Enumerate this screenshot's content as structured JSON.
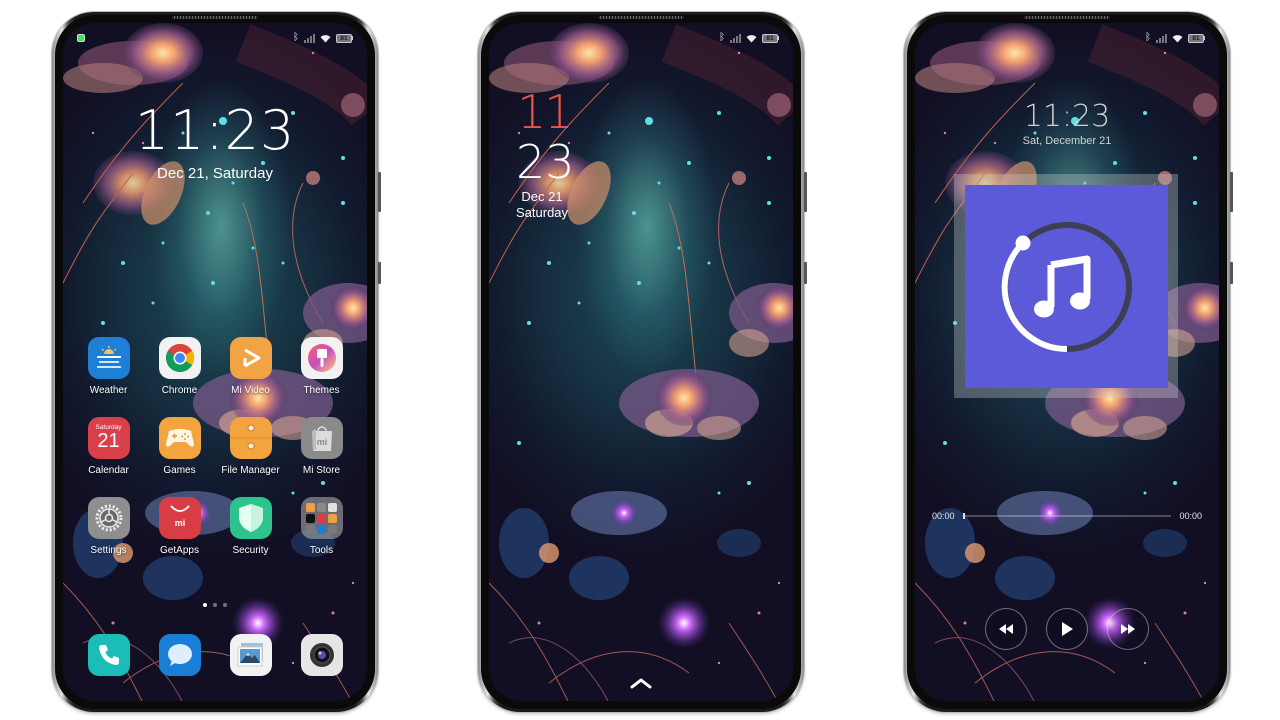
{
  "status_bar": {
    "battery_level": "81",
    "bluetooth_icon": "bluetooth-icon",
    "signal_icon": "signal-icon",
    "wifi_icon": "wifi-icon"
  },
  "home_screen": {
    "time": "11:23",
    "date": "Dec 21, Saturday",
    "apps": [
      {
        "label": "Weather",
        "icon": "weather-icon",
        "color": "#1e7fd6"
      },
      {
        "label": "Chrome",
        "icon": "chrome-icon",
        "color": "#f2f2f2"
      },
      {
        "label": "Mi Video",
        "icon": "mi-video-icon",
        "color": "#f2a444"
      },
      {
        "label": "Themes",
        "icon": "themes-icon",
        "color": "#f2f2f2"
      },
      {
        "label": "Calendar",
        "icon": "calendar-icon",
        "color": "#d8404a",
        "calendar_day": "Saturday",
        "calendar_date": "21"
      },
      {
        "label": "Games",
        "icon": "games-icon",
        "color": "#f4a43e"
      },
      {
        "label": "File Manager",
        "icon": "file-manager-icon",
        "color": "#f4a43e"
      },
      {
        "label": "Mi Store",
        "icon": "mi-store-icon",
        "color": "#8a8a8a"
      },
      {
        "label": "Settings",
        "icon": "settings-icon",
        "color": "#8e8e8e"
      },
      {
        "label": "GetApps",
        "icon": "getapps-icon",
        "color": "#d83c44"
      },
      {
        "label": "Security",
        "icon": "security-icon",
        "color": "#2cc38c"
      },
      {
        "label": "Tools",
        "icon": "tools-folder-icon",
        "color": "#9a9a9a"
      }
    ],
    "dock": [
      {
        "name": "phone",
        "icon": "phone-icon",
        "color": "#1cbcb8"
      },
      {
        "name": "messages",
        "icon": "messages-icon",
        "color": "#1a7ed6"
      },
      {
        "name": "gallery",
        "icon": "gallery-icon",
        "color": "#f2f2f2"
      },
      {
        "name": "camera",
        "icon": "camera-icon",
        "color": "#e6e6e6"
      }
    ],
    "pages": 3,
    "active_page": 1
  },
  "lock_screen_vertical": {
    "hour": "11",
    "minute": "23",
    "date_line1": "Dec 21",
    "date_line2": "Saturday",
    "hour_color": "#e8574a"
  },
  "lock_screen_music": {
    "time": "11:23",
    "date": "Sat, December 21",
    "album_color": "#5d5ad9",
    "elapsed": "00:00",
    "duration": "00:00",
    "progress_fraction": 0,
    "controls": [
      "rewind",
      "play",
      "fast-forward"
    ]
  }
}
